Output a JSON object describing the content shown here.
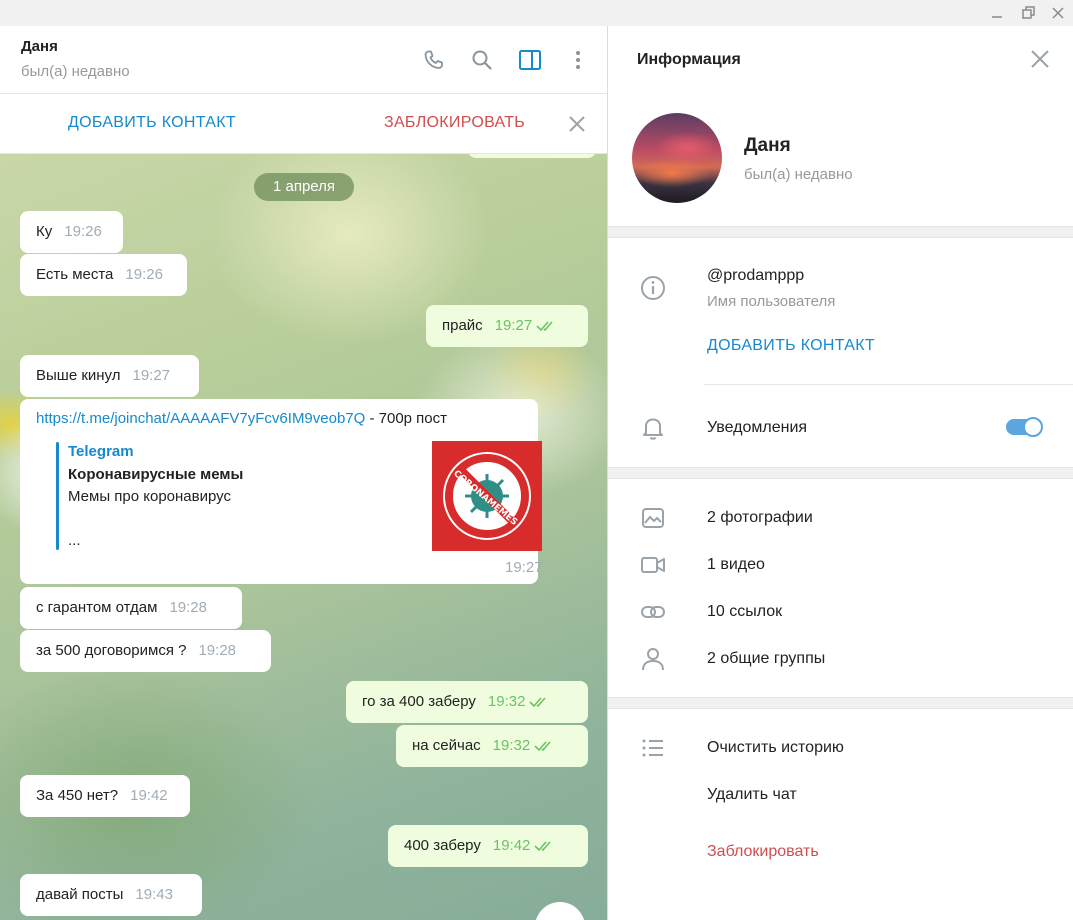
{
  "chat": {
    "peer_name": "Даня",
    "peer_status": "был(а) недавно",
    "actions": {
      "add_contact": "ДОБАВИТЬ КОНТАКТ",
      "block": "ЗАБЛОКИРОВАТЬ"
    },
    "date_pill": "1 апреля",
    "messages": [
      {
        "dir": "in",
        "text": "Ку",
        "time": "19:26"
      },
      {
        "dir": "in",
        "text": "Есть места",
        "time": "19:26"
      },
      {
        "dir": "out",
        "text": "прайс",
        "time": "19:27"
      },
      {
        "dir": "in",
        "text": "Выше кинул",
        "time": "19:27"
      },
      {
        "dir": "in",
        "text": "с гарантом отдам",
        "time": "19:28"
      },
      {
        "dir": "in",
        "text": "за 500 договоримся ?",
        "time": "19:28"
      },
      {
        "dir": "out",
        "text": "го за 400 заберу",
        "time": "19:32"
      },
      {
        "dir": "out",
        "text": "на сейчас",
        "time": "19:32"
      },
      {
        "dir": "in",
        "text": "За 450 нет?",
        "time": "19:42"
      },
      {
        "dir": "out",
        "text": "400 заберу",
        "time": "19:42"
      },
      {
        "dir": "in",
        "text": "давай посты",
        "time": "19:43"
      }
    ],
    "link_message": {
      "url": "https://t.me/joinchat/AAAAAFV7yFcv6IM9veob7Q",
      "rest": " - 700р пост",
      "preview_site": "Telegram",
      "preview_title": "Коронавирусные мемы",
      "preview_desc": "Мемы про коронавирус",
      "preview_more": "...",
      "thumb_text": "CORONAMEMES",
      "time": "19:27"
    }
  },
  "info": {
    "title": "Информация",
    "name": "Даня",
    "status": "был(а) недавно",
    "username": "@prodamppp",
    "username_label": "Имя пользователя",
    "add_contact": "ДОБАВИТЬ КОНТАКТ",
    "notifications": "Уведомления",
    "notifications_on": true,
    "media": {
      "photos": "2 фотографии",
      "videos": "1 видео",
      "links": "10 ссылок",
      "groups": "2 общие группы"
    },
    "actions": {
      "clear_history": "Очистить историю",
      "delete_chat": "Удалить чат",
      "block": "Заблокировать"
    }
  },
  "colors": {
    "accent": "#168acd",
    "danger": "#d14e4e",
    "outgoing_bubble": "#effdde",
    "read_ticks": "#6cc264"
  }
}
